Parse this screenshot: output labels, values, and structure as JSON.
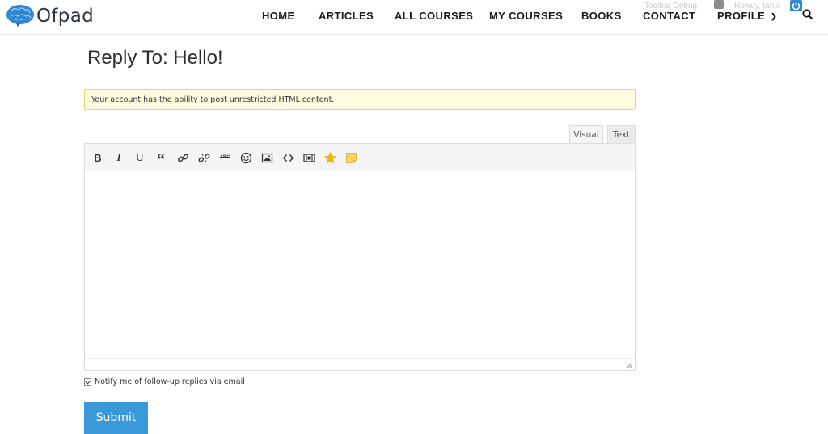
{
  "header": {
    "logo_text": "Ofpad",
    "nav": [
      "HOME",
      "ARTICLES",
      "ALL COURSES",
      "MY COURSES",
      "BOOKS",
      "CONTACT",
      "PROFILE"
    ],
    "admin_debug": "Toolbar Debug",
    "admin_howdy": "Howdy, tanuj"
  },
  "page": {
    "title": "Reply To: Hello!",
    "notice": "Your account has the ability to post unrestricted HTML content."
  },
  "editor": {
    "tabs": [
      "Visual",
      "Text"
    ],
    "active_tab": "Visual",
    "toolbar": [
      {
        "name": "bold-button",
        "label": "B"
      },
      {
        "name": "italic-button",
        "label": "I"
      },
      {
        "name": "underline-button",
        "label": "U"
      },
      {
        "name": "blockquote-button",
        "label": "“"
      },
      {
        "name": "insert-link-button",
        "icon": "link-icon"
      },
      {
        "name": "remove-link-button",
        "icon": "unlink-icon"
      },
      {
        "name": "strikethrough-button",
        "label": "ABC"
      },
      {
        "name": "emoji-button",
        "icon": "smiley-icon"
      },
      {
        "name": "insert-image-button",
        "icon": "image-icon"
      },
      {
        "name": "code-button",
        "icon": "code-icon"
      },
      {
        "name": "insert-media-button",
        "icon": "media-icon"
      },
      {
        "name": "star-button",
        "icon": "star-icon"
      },
      {
        "name": "note-button",
        "icon": "note-icon"
      }
    ],
    "content": ""
  },
  "form": {
    "notify_label": "Notify me of follow-up replies via email",
    "notify_checked": true,
    "submit_label": "Submit"
  },
  "colors": {
    "accent": "#3a9ad9",
    "notice_bg": "#fffbe0",
    "notice_border": "#e6db55",
    "logo_brain": "#2f88d1",
    "star": "#f5b400",
    "note": "#f7d463"
  }
}
